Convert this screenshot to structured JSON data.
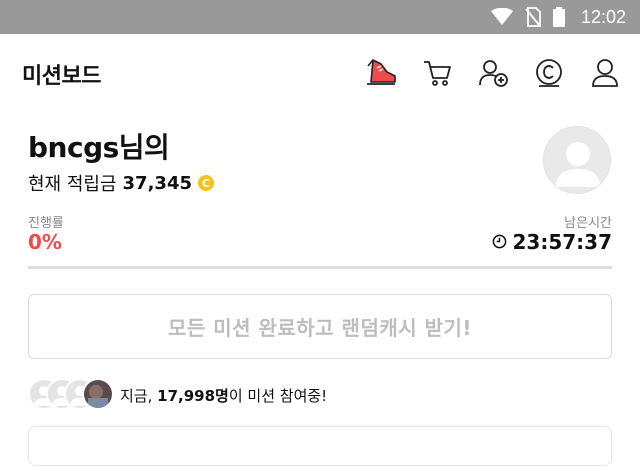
{
  "status_bar": {
    "time": "12:02",
    "icons": [
      "wifi-icon",
      "no-sim-icon",
      "battery-icon"
    ],
    "background": "#999999"
  },
  "header": {
    "title": "미션보드",
    "icons": [
      "sneaker-icon",
      "cart-icon",
      "add-friend-icon",
      "coin-icon",
      "profile-icon"
    ]
  },
  "profile": {
    "username": "bncgs",
    "username_suffix": "님의",
    "points_label": "현재 적립금",
    "points_value": "37,345",
    "coin_symbol": "C",
    "coin_color": "#f3c21b"
  },
  "progress": {
    "label": "진행률",
    "value_text": "0%",
    "fraction": 0,
    "accent": "#ee4b4b"
  },
  "timer": {
    "label": "남은시간",
    "value": "23:57:37"
  },
  "reward_button": {
    "label": "모든 미션 완료하고 랜덤캐시 받기!"
  },
  "participants": {
    "prefix": "지금,",
    "count": "17,998명",
    "suffix": "이 미션 참여중!"
  }
}
